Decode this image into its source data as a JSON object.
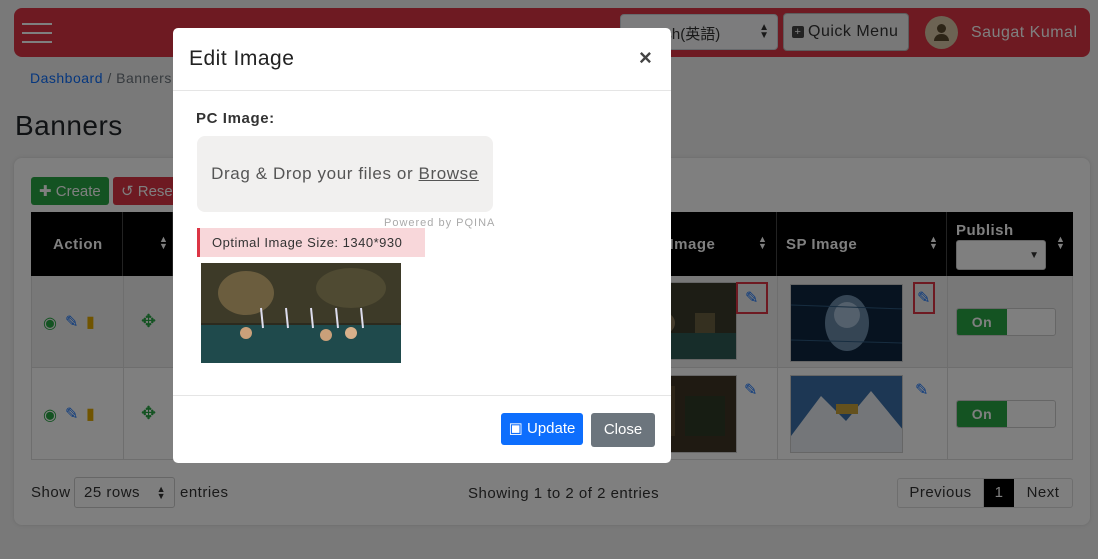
{
  "navbar": {
    "language": "English(英語)",
    "quick_menu": "Quick Menu",
    "user_name": "Saugat Kumal"
  },
  "breadcrumb": {
    "home": "Dashboard",
    "separator": "/",
    "current": "Banners"
  },
  "page": {
    "title": "Banners"
  },
  "toolbar": {
    "create_label": "Create",
    "reset_label": "Reset"
  },
  "table": {
    "headers": {
      "action": "Action",
      "pc_image": "PC Image",
      "sp_image": "SP Image",
      "publish": "Publish"
    },
    "rows": [
      {
        "publish": "On"
      },
      {
        "publish": "On"
      }
    ]
  },
  "footer": {
    "show": "Show",
    "rows_value": "25 rows",
    "entries": "entries",
    "showing": "Showing 1 to 2 of 2 entries",
    "prev": "Previous",
    "page": "1",
    "next": "Next"
  },
  "modal": {
    "title": "Edit Image",
    "close_symbol": "×",
    "field_label": "PC Image:",
    "drop_text": "Drag & Drop your files or",
    "browse": "Browse",
    "powered": "Powered by PQINA",
    "optimal": "Optimal Image Size: 1340*930",
    "update": "Update",
    "close": "Close"
  },
  "colors": {
    "primary": "#0d6efd",
    "danger": "#dc3545",
    "success": "#28a745",
    "secondary": "#6c757d"
  }
}
